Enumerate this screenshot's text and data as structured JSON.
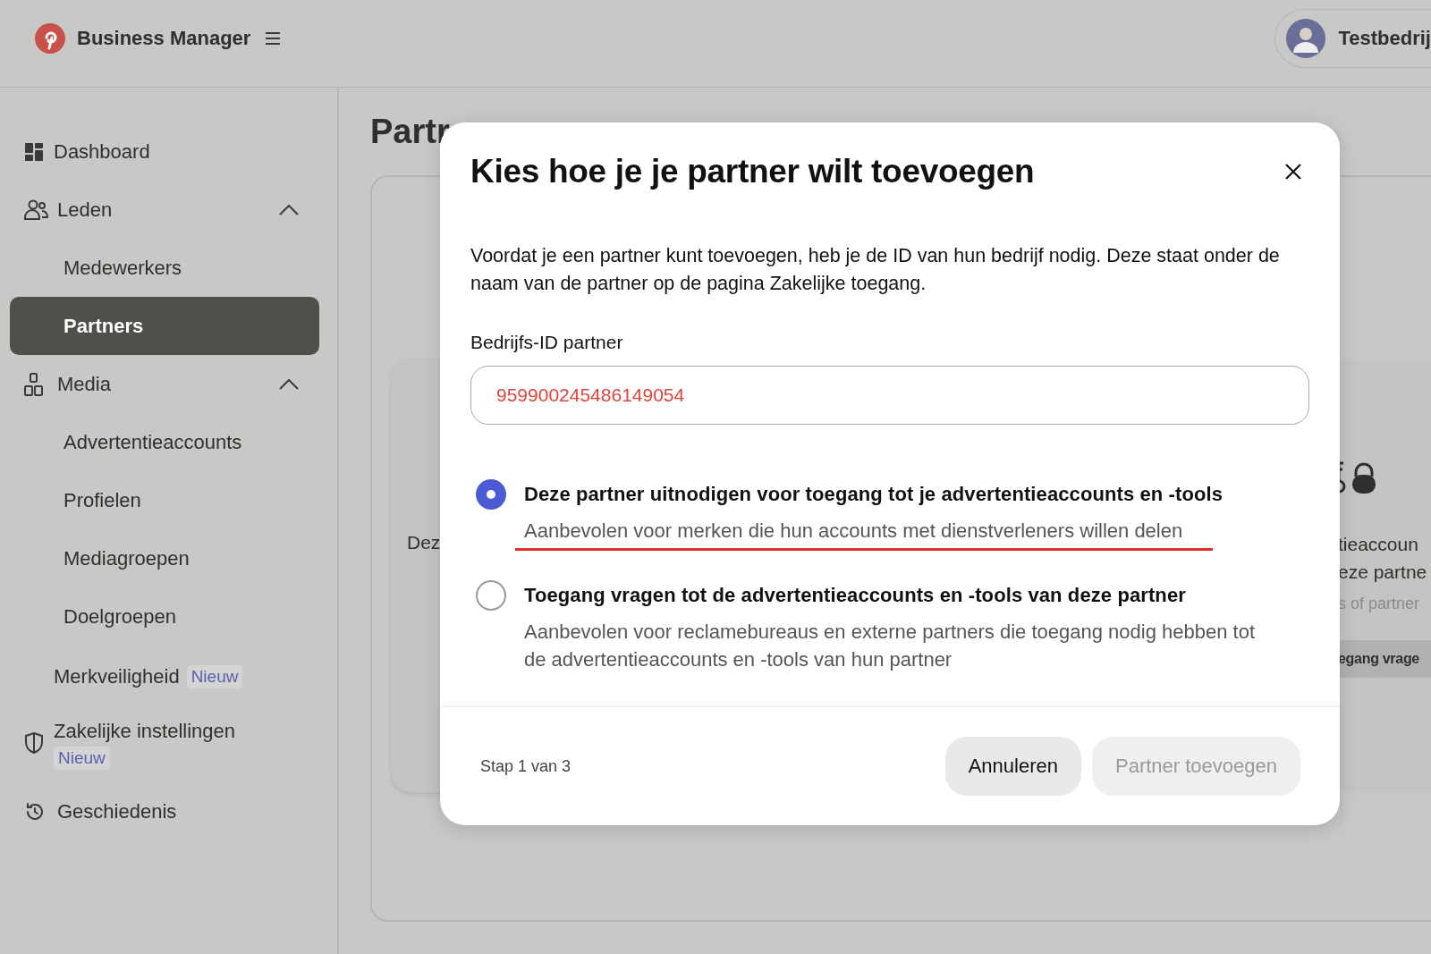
{
  "header": {
    "title": "Business Manager",
    "account": "Testbedrij"
  },
  "sidebar": {
    "items": [
      {
        "label": "Dashboard",
        "selected": false
      },
      {
        "label": "Leden",
        "selected": false,
        "expanded": true,
        "children": [
          {
            "label": "Medewerkers",
            "selected": false
          },
          {
            "label": "Partners",
            "selected": true
          }
        ]
      },
      {
        "label": "Media",
        "selected": false,
        "expanded": true,
        "children": [
          {
            "label": "Advertentieaccounts",
            "selected": false
          },
          {
            "label": "Profielen",
            "selected": false
          },
          {
            "label": "Mediagroepen",
            "selected": false
          },
          {
            "label": "Doelgroepen",
            "selected": false
          }
        ]
      },
      {
        "label": "Merkveiligheid",
        "badge": "Nieuw",
        "selected": false
      },
      {
        "label": "Zakelijke instellingen",
        "badge": "Nieuw",
        "selected": false
      },
      {
        "label": "Geschiedenis",
        "selected": false
      }
    ]
  },
  "page": {
    "title": "Partr",
    "left_card": {
      "text": "Dez"
    },
    "right_card": {
      "lines": [
        "tieaccoun",
        "eze partne"
      ],
      "note": "s of partner",
      "button": "egang vrage"
    }
  },
  "dialog": {
    "title": "Kies hoe je je partner wilt toevoegen",
    "description": "Voordat je een partner kunt toevoegen, heb je de ID van hun bedrijf nodig. Deze staat onder de naam van de partner op de pagina Zakelijke toegang.",
    "field": {
      "label": "Bedrijfs-ID partner",
      "value": "959900245486149054"
    },
    "options": [
      {
        "title": "Deze partner uitnodigen voor toegang tot je advertentieaccounts en -tools",
        "description": "Aanbevolen voor merken die hun accounts met dienstverleners willen delen",
        "selected": true,
        "underlined": true
      },
      {
        "title": "Toegang vragen tot de advertentieaccounts en -tools van deze partner",
        "description": "Aanbevolen voor reclamebureaus en externe partners die toegang nodig hebben tot de advertentieaccounts en -tools van hun partner",
        "selected": false,
        "underlined": false
      }
    ],
    "step": "Stap 1 van 3",
    "buttons": [
      {
        "label": "Annuleren",
        "disabled": false
      },
      {
        "label": "Partner toevoegen",
        "disabled": true
      }
    ]
  }
}
